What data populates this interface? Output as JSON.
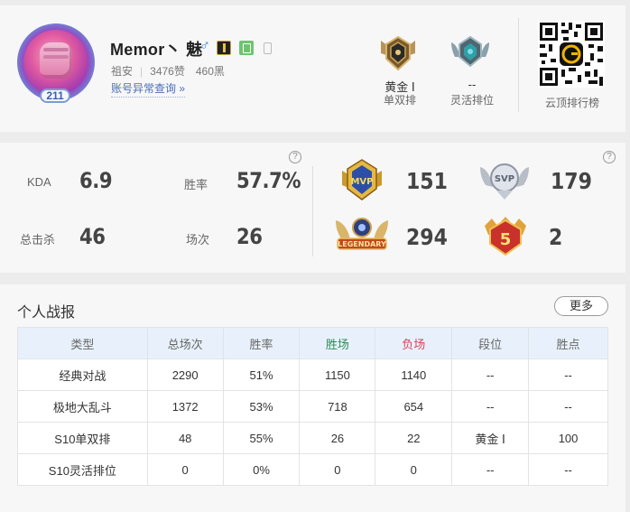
{
  "profile": {
    "name": "Memor丶 魅",
    "gender_icon": "♂",
    "level": "211",
    "region": "祖安",
    "likes": "3476赞",
    "blacks": "460黑",
    "anomaly_link": "账号异常查询 »"
  },
  "ranks": [
    {
      "title": "黄金 Ⅰ",
      "subtitle": "单双排",
      "emblem": "gold-rank-emblem"
    },
    {
      "title": "--",
      "subtitle": "灵活排位",
      "emblem": "unranked-emblem"
    }
  ],
  "qr": {
    "label": "云顶排行榜"
  },
  "stats": {
    "kda_label": "KDA",
    "kda_value": "6.9",
    "winrate_label": "胜率",
    "winrate_value": "57.7%",
    "kills_label": "总击杀",
    "kills_value": "46",
    "games_label": "场次",
    "games_value": "26",
    "help_icon": "?"
  },
  "medals": [
    {
      "name": "mvp-medal",
      "count": "151"
    },
    {
      "name": "svp-medal",
      "count": "179"
    },
    {
      "name": "legendary-medal",
      "count": "294"
    },
    {
      "name": "pentakill-medal",
      "count": "2",
      "number": "5"
    }
  ],
  "report": {
    "title": "个人战报",
    "more_label": "更多",
    "headers": [
      "类型",
      "总场次",
      "胜率",
      "胜场",
      "负场",
      "段位",
      "胜点"
    ],
    "header_colors": {
      "wins": "#2e8b57",
      "losses": "#d9435a"
    },
    "rows": [
      [
        "经典对战",
        "2290",
        "51%",
        "1150",
        "1140",
        "--",
        "--"
      ],
      [
        "极地大乱斗",
        "1372",
        "53%",
        "718",
        "654",
        "--",
        "--"
      ],
      [
        "S10单双排",
        "48",
        "55%",
        "26",
        "22",
        "黄金 Ⅰ",
        "100"
      ],
      [
        "S10灵活排位",
        "0",
        "0%",
        "0",
        "0",
        "--",
        "--"
      ]
    ]
  }
}
